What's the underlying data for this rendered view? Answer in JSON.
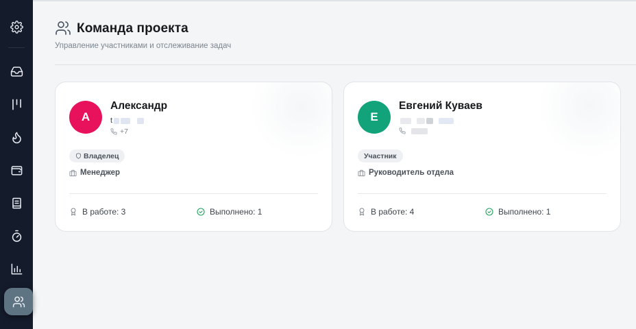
{
  "sidebar": {
    "items": [
      {
        "icon": "gear-icon"
      },
      {
        "icon": "inbox-icon"
      },
      {
        "icon": "kanban-icon"
      },
      {
        "icon": "flame-icon"
      },
      {
        "icon": "wallet-icon"
      },
      {
        "icon": "notebook-icon"
      },
      {
        "icon": "timer-icon"
      },
      {
        "icon": "bar-chart-icon"
      },
      {
        "icon": "users-icon",
        "active": true
      }
    ]
  },
  "header": {
    "icon": "users-icon",
    "title": "Команда проекта",
    "subtitle": "Управление участниками и отслеживание задач"
  },
  "members": [
    {
      "initial": "А",
      "avatar_color": "#e8125c",
      "name": "Александр",
      "email_visible": "t",
      "phone_visible": "+7",
      "role": "Владелец",
      "position": "Менеджер",
      "in_progress_label": "В работе: 3",
      "done_label": "Выполнено: 1"
    },
    {
      "initial": "Е",
      "avatar_color": "#12a37a",
      "name": "Евгений Куваев",
      "email_visible": "",
      "phone_visible": "",
      "role": "Участник",
      "position": "Руководитель отдела",
      "in_progress_label": "В работе: 4",
      "done_label": "Выполнено: 1"
    }
  ],
  "colors": {
    "sidebar_bg": "#141b2b",
    "sidebar_active": "#5f7482",
    "page_bg": "#f3f5f7",
    "done_green": "#1fa35e"
  }
}
